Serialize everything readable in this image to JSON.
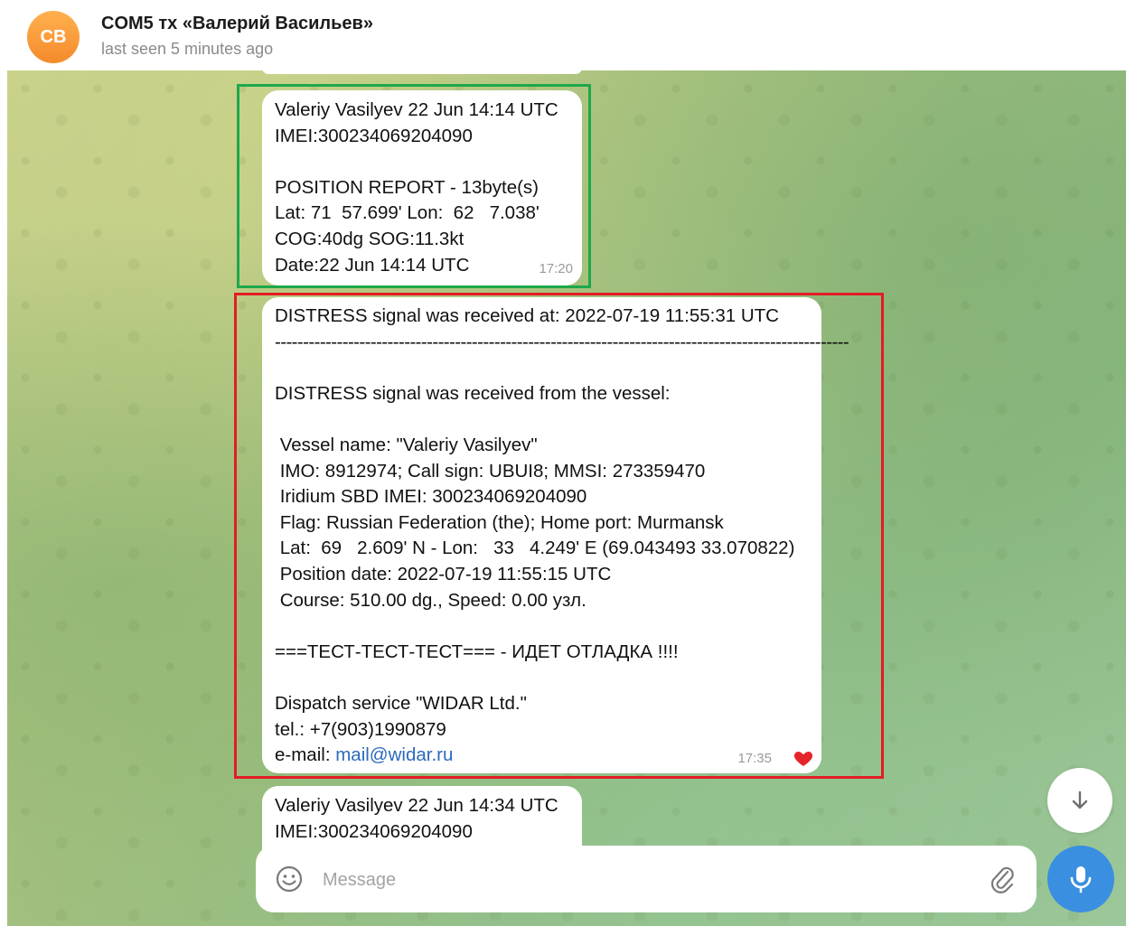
{
  "header": {
    "avatar_initials": "CB",
    "title": "COM5 тх «Валерий Васильев»",
    "status": "last seen 5 minutes ago"
  },
  "messages": [
    {
      "lines": [
        "Valeriy Vasilyev 22 Jun 14:14 UTC",
        "IMEI:300234069204090",
        "",
        "POSITION REPORT - 13byte(s)",
        "Lat: 71  57.699' Lon:  62   7.038'",
        "COG:40dg SOG:11.3kt",
        "Date:22 Jun 14:14 UTC"
      ],
      "time": "17:20"
    },
    {
      "lines": [
        "DISTRESS signal was received at: 2022-07-19 11:55:31 UTC",
        "------------------------------------------------------------------------------------------------------",
        "",
        "DISTRESS signal was received from the vessel:",
        "",
        " Vessel name: \"Valeriy Vasilyev\"",
        " IMO: 8912974; Call sign: UBUI8; MMSI: 273359470",
        " Iridium SBD IMEI: 300234069204090",
        " Flag: Russian Federation (the); Home port: Murmansk",
        " Lat:  69   2.609' N - Lon:   33   4.249' E (69.043493 33.070822)",
        " Position date: 2022-07-19 11:55:15 UTC",
        " Course: 510.00 dg., Speed: 0.00 узл.",
        "",
        "===ТЕСТ-ТЕСТ-ТЕСТ=== - ИДЕТ ОТЛАДКА !!!!",
        "",
        "Dispatch service \"WIDAR Ltd.\"",
        "tel.: +7(903)1990879"
      ],
      "email_label": "e-mail: ",
      "email": "mail@widar.ru",
      "time": "17:35",
      "reaction": "heart"
    },
    {
      "lines": [
        "Valeriy Vasilyev 22 Jun 14:34 UTC",
        "IMEI:300234069204090"
      ]
    }
  ],
  "composer": {
    "placeholder": "Message"
  },
  "colors": {
    "highlight_green": "#1ea84a",
    "highlight_red": "#e21d24",
    "accent_blue": "#3a8fe0",
    "avatar_orange": "#f58a2b"
  },
  "icons": [
    "emoji-icon",
    "paperclip-icon",
    "microphone-icon",
    "arrow-down-icon",
    "heart-icon"
  ]
}
